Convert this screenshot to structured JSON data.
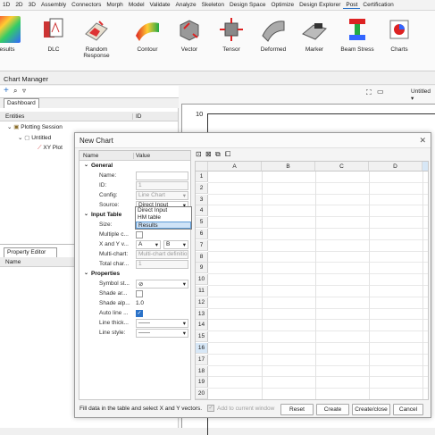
{
  "menu": [
    "1D",
    "2D",
    "3D",
    "Assembly",
    "Connectors",
    "Morph",
    "Model",
    "Validate",
    "Analyze",
    "Skeleton",
    "Design Space",
    "Optimize",
    "Design Explorer",
    "Post",
    "Certification"
  ],
  "ribbon": [
    {
      "label": "esults",
      "icon": "results-icon"
    },
    {
      "label": "DLC",
      "icon": "dlc-icon"
    },
    {
      "label": "Random Response",
      "icon": "random-response-icon"
    },
    {
      "label": "Contour",
      "icon": "contour-icon"
    },
    {
      "label": "Vector",
      "icon": "vector-icon"
    },
    {
      "label": "Tensor",
      "icon": "tensor-icon"
    },
    {
      "label": "Deformed",
      "icon": "deformed-icon"
    },
    {
      "label": "Marker",
      "icon": "marker-icon"
    },
    {
      "label": "Beam Stress",
      "icon": "beam-stress-icon"
    },
    {
      "label": "Charts",
      "icon": "charts-icon"
    }
  ],
  "chart_manager": {
    "title": "Chart Manager",
    "tab": "Dashboard",
    "entities_header": "Entities",
    "id_header": "ID",
    "tree": [
      "Plotting Session",
      "Untitled",
      "XY Plot"
    ],
    "property_editor": "Property Editor",
    "name_header": "Name",
    "untitled_select": "Untitled",
    "plot_tick": "10"
  },
  "dialog": {
    "title": "New Chart",
    "col_name": "Name",
    "col_value": "Value",
    "general": "General",
    "rows_general": [
      {
        "label": "Name:",
        "value": ""
      },
      {
        "label": "ID:",
        "value": "1"
      },
      {
        "label": "Config:",
        "value": "Line Chart"
      },
      {
        "label": "Source:",
        "value": "Direct Input"
      }
    ],
    "input_table": "Input Table",
    "rows_input": [
      {
        "label": "Size:",
        "value": ""
      },
      {
        "label": "Multiple c...",
        "value": ""
      },
      {
        "label": "X and Y v...",
        "value": "A"
      },
      {
        "label": "Multi-chart:",
        "value": "Multi-chart definition"
      },
      {
        "label": "Total char...",
        "value": "1"
      }
    ],
    "xy_second": "B",
    "properties": "Properties",
    "rows_props": [
      {
        "label": "Symbol st...",
        "value": "⊘"
      },
      {
        "label": "Shade ar...",
        "value": ""
      },
      {
        "label": "Shade alp...",
        "value": "1.0"
      },
      {
        "label": "Auto line ...",
        "value": "✓"
      },
      {
        "label": "Line thick...",
        "value": "——"
      },
      {
        "label": "Line style:",
        "value": "——"
      }
    ],
    "dropdown": [
      "Direct Input",
      "HM table",
      "Results"
    ],
    "grid_cols": [
      "A",
      "B",
      "C",
      "D"
    ],
    "grid_rows": [
      "1",
      "2",
      "3",
      "4",
      "5",
      "6",
      "7",
      "8",
      "9",
      "10",
      "11",
      "12",
      "13",
      "14",
      "15",
      "16",
      "17",
      "18",
      "19",
      "20"
    ],
    "footer_text": "Fill data in the table and select X and Y vectors.",
    "add_current": "Add to current window",
    "buttons": {
      "reset": "Reset",
      "create": "Create",
      "create_close": "Create/close",
      "cancel": "Cancel"
    }
  },
  "colors": {
    "accent": "#2a72c8",
    "selection": "#cfe3f7"
  }
}
